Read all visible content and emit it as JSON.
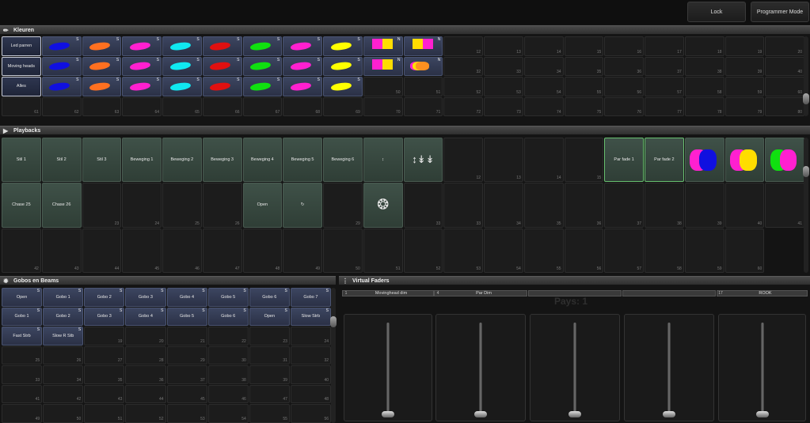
{
  "toolbar": {
    "lock_label": "Lock",
    "mode_label": "Programmer Mode"
  },
  "kleuren": {
    "title": "Kleuren",
    "rows": [
      {
        "label": "Led parren",
        "cells": [
          "#1010e0",
          "#ff7020",
          "#ff20d0",
          "#10e8f0",
          "#e01010",
          "#10e010",
          "#ff20d0",
          "#ffff00"
        ],
        "special": [
          {
            "type": "split",
            "colors": [
              "#ff20d0",
              "#ffdd00"
            ],
            "tag": "N"
          },
          {
            "type": "split",
            "colors": [
              "#ffdd00",
              "#ff20d0"
            ],
            "tag": "N"
          }
        ],
        "nums": [
          "12",
          "13",
          "14",
          "15",
          "16",
          "17",
          "18",
          "19",
          "20"
        ]
      },
      {
        "label": "Moving heads",
        "cells": [
          "#1010e0",
          "#ff7020",
          "#ff20d0",
          "#10e8f0",
          "#e01010",
          "#10e010",
          "#ff20d0",
          "#ffff00"
        ],
        "special": [
          {
            "type": "split",
            "colors": [
              "#ff20d0",
              "#ffdd00"
            ],
            "tag": "N"
          },
          {
            "type": "multi",
            "colors": [
              "#ff20d0",
              "#ffdd00",
              "#ff9020"
            ],
            "tag": "N"
          }
        ],
        "nums": [
          "32",
          "33",
          "34",
          "35",
          "36",
          "37",
          "38",
          "39",
          "40"
        ]
      },
      {
        "label": "Alles",
        "cells": [
          "#1010e0",
          "#ff7020",
          "#ff20d0",
          "#10e8f0",
          "#e01010",
          "#10e010",
          "#ff20d0",
          "#ffff00"
        ],
        "special": [],
        "nums": [
          "50",
          "51",
          "52",
          "53",
          "54",
          "55",
          "56",
          "57",
          "58",
          "59",
          "60"
        ]
      },
      {
        "nums": [
          "61",
          "62",
          "63",
          "64",
          "65",
          "66",
          "67",
          "68",
          "69",
          "70",
          "71",
          "72",
          "73",
          "74",
          "75",
          "76",
          "77",
          "78",
          "79",
          "80"
        ]
      }
    ]
  },
  "playbacks": {
    "title": "Playbacks",
    "row1": [
      "Stil 1",
      "Stil 2",
      "Stil 3",
      "Beweging 1",
      "Beweging 2",
      "Beweging 3",
      "Beweging 4",
      "Beweging 5",
      "Beweging 6"
    ],
    "row1_icons": [
      "up-down-arrow-icon",
      "triple-arrow-icon"
    ],
    "row1_nums": [
      "12",
      "13",
      "14",
      "15"
    ],
    "row1_fades": [
      "Par fade 1",
      "Par fade 2"
    ],
    "row1_colors": [
      [
        "#ff20d0",
        "#1010e0"
      ],
      [
        "#ff20d0",
        "#ffdd00"
      ],
      [
        "#10e010",
        "#ff20d0"
      ]
    ],
    "row2_labels": [
      "Chase 25",
      "Chase 26"
    ],
    "row2_nums": [
      "23",
      "24",
      "25",
      "26"
    ],
    "row2_open": "Open",
    "row2_nums2": [
      "29",
      "33",
      "33",
      "34",
      "35",
      "36",
      "37",
      "38",
      "39",
      "40"
    ],
    "row3_nums": [
      "41",
      "42",
      "43",
      "44",
      "45",
      "46",
      "47",
      "48",
      "49",
      "50",
      "51",
      "52",
      "53",
      "54",
      "55",
      "56",
      "57",
      "58",
      "59",
      "60"
    ]
  },
  "gobos": {
    "title": "Gobos en Beams",
    "row1": [
      "Open",
      "Gobo 1",
      "Gobo 2",
      "Gobo 3",
      "Gobo 4",
      "Gobo 5",
      "Gobo 6",
      "Gobo 7"
    ],
    "row2": [
      "Gobo 1",
      "Gobo 2",
      "Gobo 3",
      "Gobo 4",
      "Gobo 5",
      "Gobo 6",
      "Open",
      "Slow Strb"
    ],
    "row3": [
      "Fast Strb",
      "Slow R Stb"
    ],
    "row3_nums": [
      "19",
      "20",
      "21",
      "22",
      "23",
      "24"
    ],
    "row4_nums": [
      "25",
      "26",
      "27",
      "28",
      "29",
      "30",
      "31",
      "32"
    ],
    "row5_nums": [
      "33",
      "34",
      "35",
      "36",
      "37",
      "38",
      "39",
      "40"
    ],
    "row6_nums": [
      "41",
      "42",
      "43",
      "44",
      "45",
      "46",
      "47",
      "48"
    ],
    "row7_nums": [
      "49",
      "50",
      "51",
      "52",
      "53",
      "54",
      "55",
      "56"
    ]
  },
  "virtual_faders": {
    "title": "Virtual Faders",
    "headers": [
      {
        "n": "1",
        "t": "Movinghead dim"
      },
      {
        "n": "4",
        "t": "Par Dim"
      },
      {
        "n": "",
        "t": ""
      },
      {
        "n": "",
        "t": ""
      },
      {
        "n": "17",
        "t": "ROOK"
      }
    ],
    "pages_text": "Pays: 1"
  }
}
